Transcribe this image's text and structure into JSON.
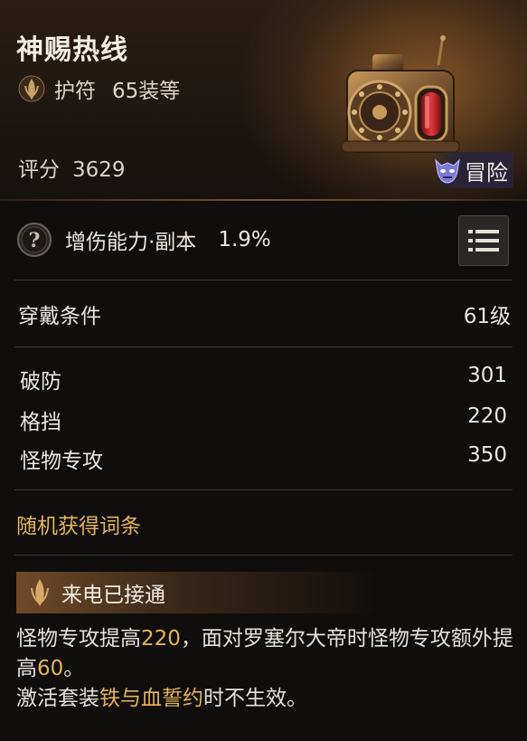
{
  "item": {
    "name": "神赐热线",
    "type": "护符",
    "level": "65装等",
    "score_label": "评分",
    "score_value": "3629",
    "badge": "冒险"
  },
  "main_stat": {
    "label": "增伤能力·副本",
    "value": "1.9%"
  },
  "requirement": {
    "label": "穿戴条件",
    "value": "61级"
  },
  "attributes": [
    {
      "label": "破防",
      "value": "301"
    },
    {
      "label": "格挡",
      "value": "220"
    },
    {
      "label": "怪物专攻",
      "value": "350"
    }
  ],
  "random_affix_label": "随机获得词条",
  "set_effect": {
    "name": "来电已接通",
    "desc": {
      "p1": "怪物专攻提高",
      "v1": "220",
      "p2": "，面对罗塞尔大帝时怪物专攻额外提高",
      "v2": "60",
      "p3": "。",
      "p4": "激活套装",
      "set_name": "铁与血誓约",
      "p5": "时不生效。"
    }
  },
  "colors": {
    "highlight": "#e3b45a",
    "text": "#ece6de",
    "background": "#100e0d"
  }
}
